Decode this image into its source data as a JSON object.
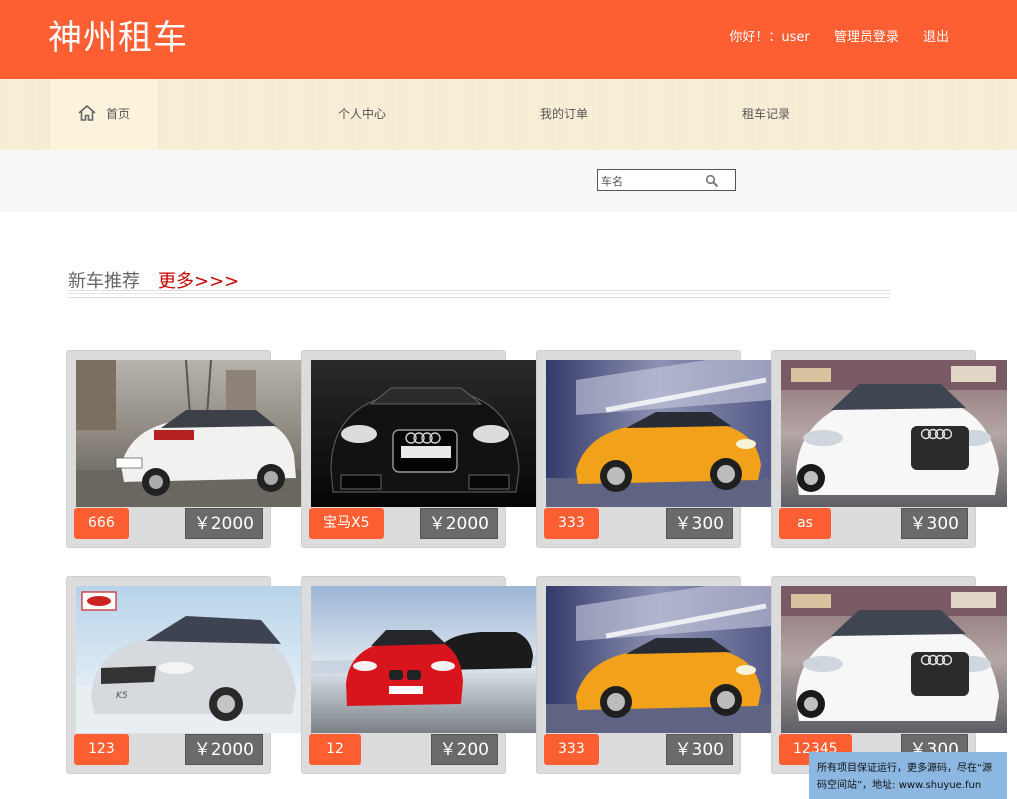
{
  "header": {
    "logo": "神州租车",
    "greeting": "你好！：user",
    "admin_login": "管理员登录",
    "logout": "退出"
  },
  "nav": {
    "home": "首页",
    "personal": "个人中心",
    "orders": "我的订单",
    "records": "租车记录"
  },
  "search": {
    "placeholder": "车名"
  },
  "section": {
    "title": "新车推荐",
    "more": "更多>>>"
  },
  "cars": [
    {
      "name": "666",
      "price": "￥2000",
      "image": "white-sedan"
    },
    {
      "name": "宝马X5",
      "price": "￥2000",
      "image": "black-audi-tt"
    },
    {
      "name": "333",
      "price": "￥300",
      "image": "yellow-audi-tt"
    },
    {
      "name": "as",
      "price": "￥300",
      "image": "white-audi-a8"
    },
    {
      "name": "123",
      "price": "￥2000",
      "image": "silver-kia-k5"
    },
    {
      "name": "12",
      "price": "￥200",
      "image": "red-bmw"
    },
    {
      "name": "333",
      "price": "￥300",
      "image": "yellow-audi-tt"
    },
    {
      "name": "12345",
      "price": "￥300",
      "image": "white-audi-a8"
    }
  ],
  "notice": "所有项目保证运行，更多源码，尽在“源码空间站”，地址: www.shuyue.fun",
  "colors": {
    "brand": "#fd5e32",
    "nav_bg": "#f6ecd2",
    "price_bg": "#6a6a6a"
  }
}
